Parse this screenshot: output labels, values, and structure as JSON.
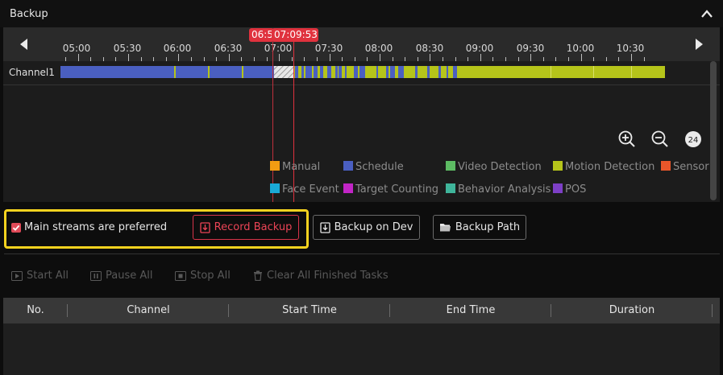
{
  "window": {
    "title": "Backup"
  },
  "timeline": {
    "ticks": [
      "05:00",
      "05:30",
      "06:00",
      "06:30",
      "07:00",
      "07:30",
      "08:00",
      "08:30",
      "09:00",
      "09:30",
      "10:00",
      "10:30"
    ],
    "cursor_start_label": "06:5",
    "cursor_end_label": "07:09:53",
    "channel": "Channel1"
  },
  "zoom": {
    "level": "24"
  },
  "legend": [
    {
      "label": "Manual",
      "color": "#f39c12"
    },
    {
      "label": "Schedule",
      "color": "#4a5fc1"
    },
    {
      "label": "Video Detection",
      "color": "#5dbb63"
    },
    {
      "label": "Motion Detection",
      "color": "#b5c41a"
    },
    {
      "label": "Sensor",
      "color": "#e8562a"
    },
    {
      "label": "Face Event",
      "color": "#1aa9d6"
    },
    {
      "label": "Target Counting",
      "color": "#c225c6"
    },
    {
      "label": "Behavior Analysis",
      "color": "#3fb59b"
    },
    {
      "label": "POS",
      "color": "#7d3fc6"
    }
  ],
  "backup": {
    "main_streams_label": "Main streams are preferred",
    "main_streams_checked": true,
    "record_backup": "Record Backup",
    "backup_on_dev": "Backup on Dev",
    "backup_path": "Backup Path"
  },
  "toolbar": {
    "start_all": "Start All",
    "pause_all": "Pause All",
    "stop_all": "Stop All",
    "clear_finished": "Clear All Finished Tasks"
  },
  "table": {
    "columns": [
      "No.",
      "Channel",
      "Start Time",
      "End Time",
      "Duration"
    ]
  },
  "colors": {
    "accent_red": "#e0323e",
    "highlight": "#f5d21f"
  }
}
